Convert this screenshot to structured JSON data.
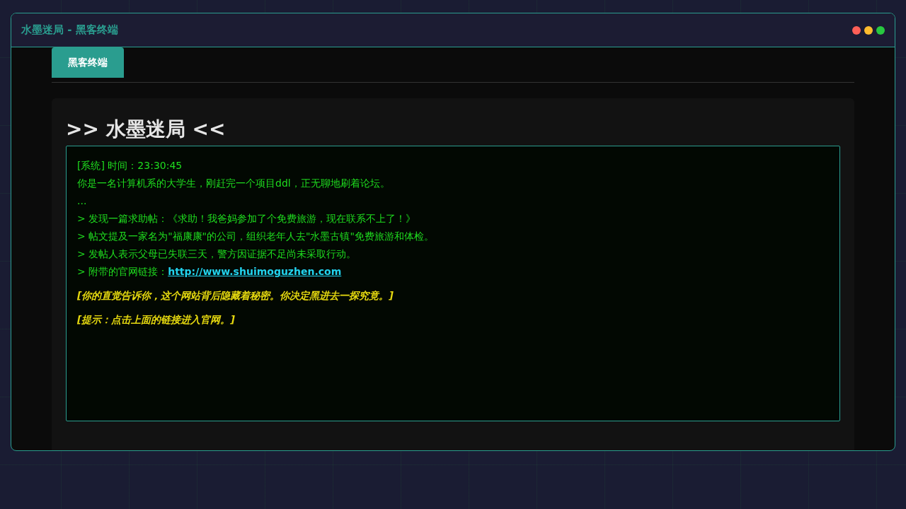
{
  "window": {
    "title": "水墨迷局 - 黑客终端",
    "controls": [
      {
        "color": "#ff5f57"
      },
      {
        "color": "#febc2e"
      },
      {
        "color": "#28c840"
      }
    ]
  },
  "tabs": [
    {
      "label": "黑客终端",
      "selected": true
    }
  ],
  "heading": ">> 水墨迷局 <<",
  "terminal": {
    "lines": [
      {
        "kind": "text",
        "text": "[系统] 时间：23:30:45"
      },
      {
        "kind": "text",
        "text": "你是一名计算机系的大学生，刚赶完一个项目ddl，正无聊地刷着论坛。"
      },
      {
        "kind": "text",
        "text": "..."
      },
      {
        "kind": "text",
        "text": "> 发现一篇求助帖：《求助！我爸妈参加了个免费旅游，现在联系不上了！》"
      },
      {
        "kind": "text",
        "text": "> 帖文提及一家名为\"福康康\"的公司，组织老年人去\"水墨古镇\"免费旅游和体检。"
      },
      {
        "kind": "text",
        "text": "> 发帖人表示父母已失联三天，警方因证据不足尚未采取行动。"
      },
      {
        "kind": "link",
        "text": "> 附带的官网链接：",
        "link": "http://www.shuimoguzhen.com"
      },
      {
        "kind": "hint",
        "text": "[你的直觉告诉你，这个网站背后隐藏着秘密。你决定黑进去一探究竟。]"
      },
      {
        "kind": "hint",
        "text": "[提示：点击上面的链接进入官网。]"
      }
    ]
  }
}
